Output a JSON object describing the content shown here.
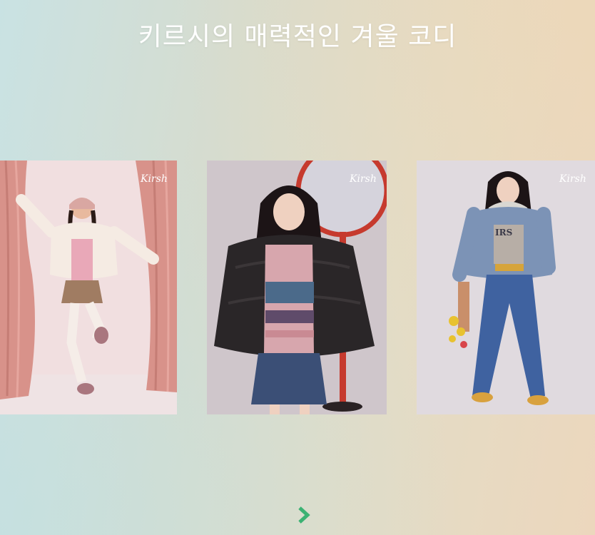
{
  "page": {
    "title": "키르시의 매력적인 겨울 코디"
  },
  "carousel": {
    "slides": [
      {
        "brand_mark": "Kirsh",
        "icon": "photo-pink-padding-look"
      },
      {
        "brand_mark": "Kirsh",
        "icon": "photo-black-padding-look"
      },
      {
        "brand_mark": "Kirsh",
        "icon": "photo-check-padding-look"
      }
    ],
    "next_icon": "chevron-right-icon"
  },
  "colors": {
    "title": "#ffffff",
    "arrow": "#3bb273"
  }
}
